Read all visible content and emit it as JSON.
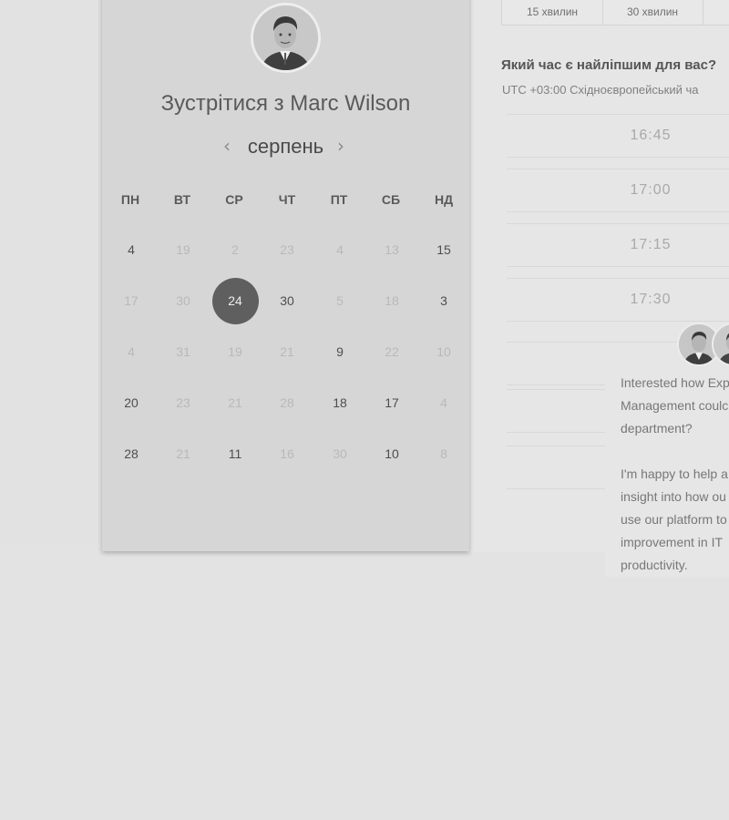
{
  "header": {
    "title": "Зустрітися з Marc Wilson"
  },
  "calendar": {
    "month": "серпень",
    "prev_icon": "‹",
    "next_icon": "›",
    "weekdays": [
      "ПН",
      "ВТ",
      "СР",
      "ЧТ",
      "ПТ",
      "СБ",
      "НД"
    ],
    "weeks": [
      [
        {
          "v": "4",
          "s": "active"
        },
        {
          "v": "19",
          "s": "muted"
        },
        {
          "v": "2",
          "s": "muted"
        },
        {
          "v": "23",
          "s": "muted"
        },
        {
          "v": "4",
          "s": "muted"
        },
        {
          "v": "13",
          "s": "muted"
        },
        {
          "v": "15",
          "s": "active"
        }
      ],
      [
        {
          "v": "17",
          "s": "muted"
        },
        {
          "v": "30",
          "s": "muted"
        },
        {
          "v": "24",
          "s": "selected"
        },
        {
          "v": "30",
          "s": "active"
        },
        {
          "v": "5",
          "s": "muted"
        },
        {
          "v": "18",
          "s": "muted"
        },
        {
          "v": "3",
          "s": "active"
        }
      ],
      [
        {
          "v": "4",
          "s": "muted"
        },
        {
          "v": "31",
          "s": "muted"
        },
        {
          "v": "19",
          "s": "muted"
        },
        {
          "v": "21",
          "s": "muted"
        },
        {
          "v": "9",
          "s": "active"
        },
        {
          "v": "22",
          "s": "muted"
        },
        {
          "v": "10",
          "s": "muted"
        }
      ],
      [
        {
          "v": "20",
          "s": "active"
        },
        {
          "v": "23",
          "s": "muted"
        },
        {
          "v": "21",
          "s": "muted"
        },
        {
          "v": "28",
          "s": "muted"
        },
        {
          "v": "18",
          "s": "active"
        },
        {
          "v": "17",
          "s": "active"
        },
        {
          "v": "4",
          "s": "muted"
        }
      ],
      [
        {
          "v": "28",
          "s": "active"
        },
        {
          "v": "21",
          "s": "muted"
        },
        {
          "v": "11",
          "s": "active"
        },
        {
          "v": "16",
          "s": "muted"
        },
        {
          "v": "30",
          "s": "muted"
        },
        {
          "v": "10",
          "s": "active"
        },
        {
          "v": "8",
          "s": "muted"
        }
      ]
    ]
  },
  "durations": [
    "15 хвилин",
    "30 хвилин"
  ],
  "schedule": {
    "question": "Який час є найліпшим для вас?",
    "timezone": "UTC +03:00 Східноєвропейський ча",
    "slots": [
      "16:45",
      "17:00",
      "17:15",
      "17:30"
    ]
  },
  "chat": {
    "paragraphs": [
      [
        "Interested how Exp",
        "Management coulc",
        "department?"
      ],
      [
        "I'm happy to help a",
        "insight into how ou",
        "use our platform to",
        "improvement in IT",
        "productivity."
      ]
    ]
  },
  "colors": {
    "selected_day": "#5f5f5f",
    "card": "#d6d6d6",
    "background": "#e3e3e3"
  }
}
